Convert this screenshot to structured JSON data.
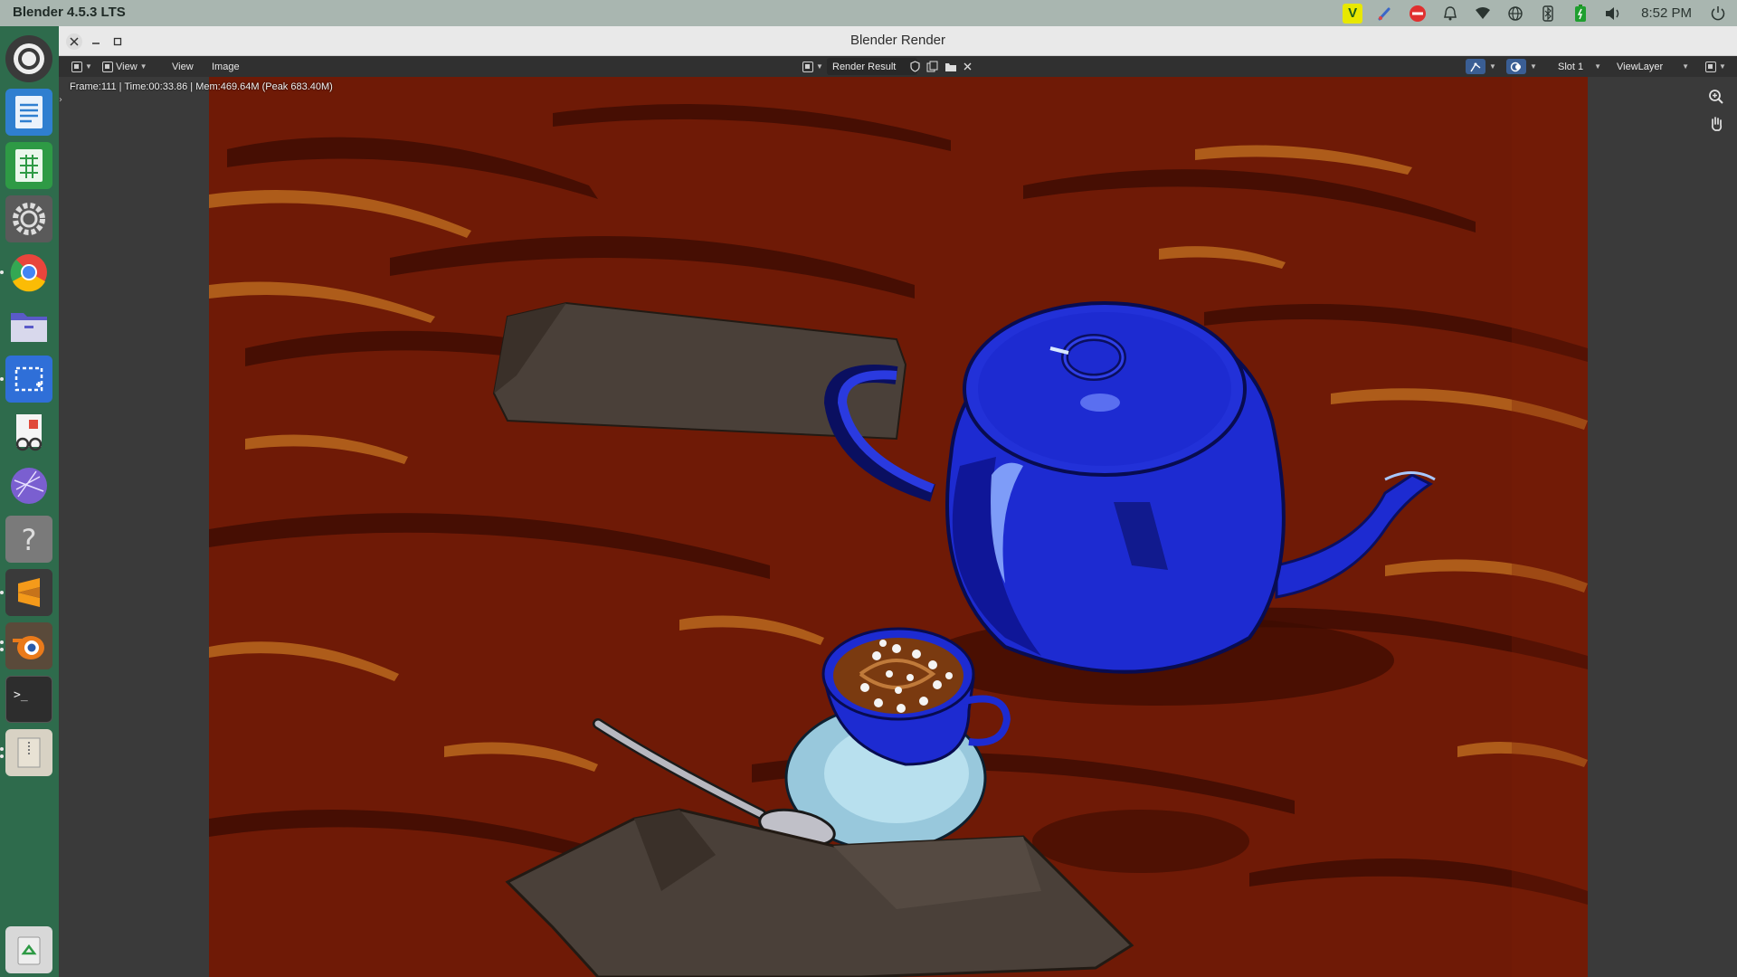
{
  "topbar": {
    "app_title": "Blender 4.5.3 LTS",
    "clock": "8:52 PM",
    "tray_icons": [
      "vim-icon",
      "brush-icon",
      "do-not-disturb-icon",
      "bell-icon",
      "wifi-icon",
      "globe-icon",
      "bluetooth-icon",
      "battery-icon",
      "volume-icon",
      "power-icon"
    ],
    "vim_label": "V"
  },
  "dock": {
    "items": [
      "ubuntu-software",
      "writer",
      "calc",
      "settings",
      "chrome",
      "files",
      "screenshot",
      "document-viewer",
      "vpn",
      "help",
      "sublime-text",
      "blender",
      "terminal",
      "archive",
      "trash"
    ]
  },
  "window": {
    "title": "Blender Render",
    "header": {
      "view_menu_1": "View",
      "view_menu_2": "View",
      "image_menu": "Image",
      "image_name": "Render Result",
      "slot": "Slot 1",
      "view_layer": "ViewLayer"
    },
    "info": "Frame:111 | Time:00:33.86 | Mem:469.64M (Peak 683.40M)"
  },
  "colors": {
    "dock_bg": "#2e6b4c",
    "topbar_bg": "#a9b6b0",
    "wood": "#6f1a06",
    "teapot": "#1d2bd1"
  }
}
